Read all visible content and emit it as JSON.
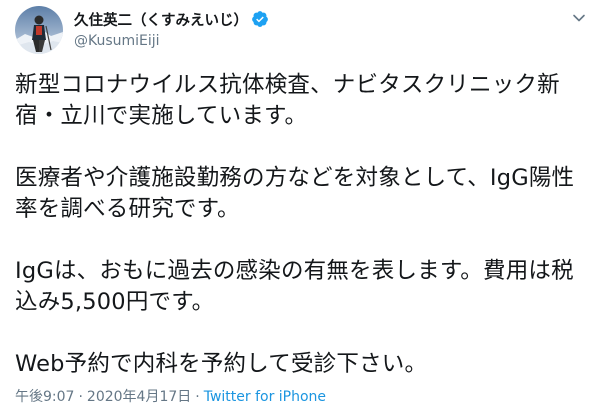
{
  "author": {
    "display_name": "久住英二（くすみえいじ）",
    "handle": "@KusumiEiji",
    "verified": true
  },
  "tweet": {
    "text": "新型コロナウイルス抗体検査、ナビタスクリニック新宿・立川で実施しています。\n\n医療者や介護施設勤務の方などを対象として、IgG陽性率を調べる研究です。\n\nIgGは、おもに過去の感染の有無を表します。費用は税込み5,500円です。\n\nWeb予約で内科を予約して受診下さい。"
  },
  "meta": {
    "time": "午後9:07",
    "separator": "·",
    "date": "2020年4月17日",
    "source": "Twitter for iPhone"
  },
  "icons": {
    "verified": "verified-badge-icon",
    "menu": "chevron-down-icon"
  },
  "colors": {
    "verified": "#1da1f2",
    "source_link": "#1b95e0",
    "secondary_text": "#657786"
  }
}
